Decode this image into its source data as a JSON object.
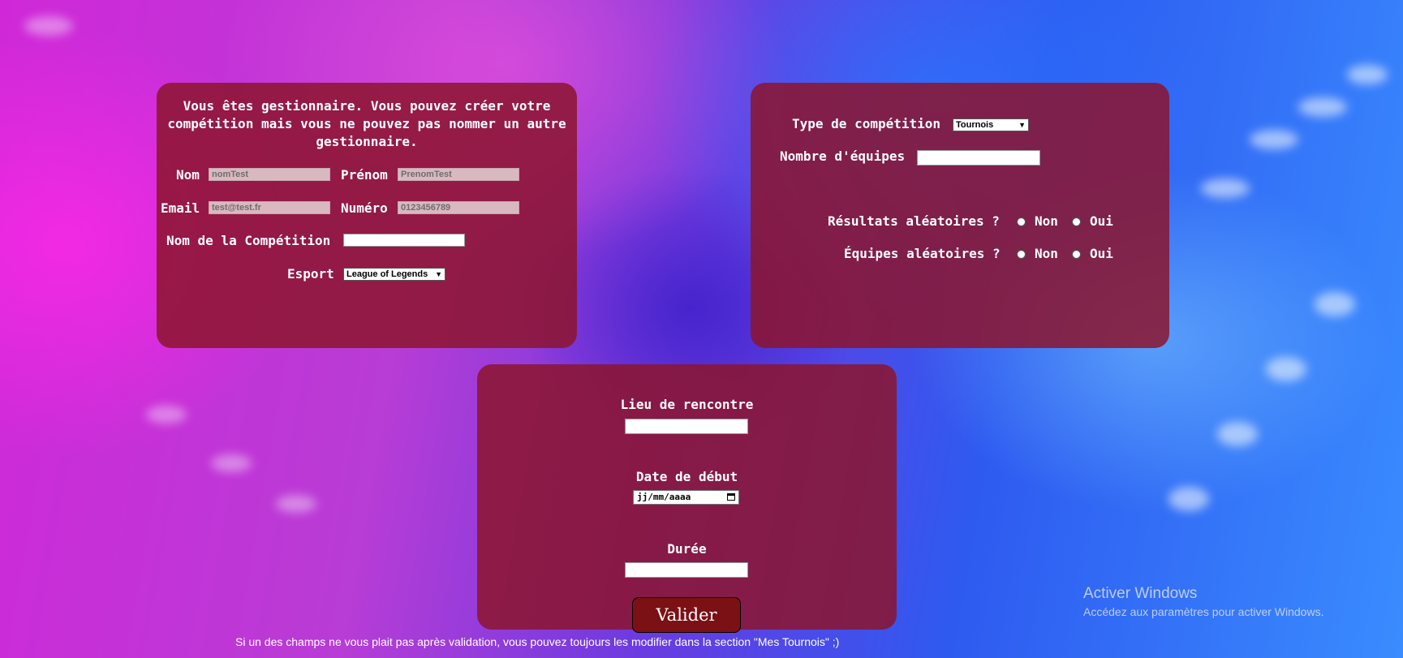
{
  "panel_left": {
    "intro": "Vous êtes gestionnaire. Vous pouvez créer votre compétition mais vous ne pouvez pas nommer un autre gestionnaire.",
    "nom_label": "Nom",
    "nom_value": "nomTest",
    "prenom_label": "Prénom",
    "prenom_value": "PrenomTest",
    "email_label": "Email",
    "email_value": "test@test.fr",
    "numero_label": "Numéro",
    "numero_value": "0123456789",
    "competition_name_label": "Nom de la Compétition",
    "competition_name_value": "",
    "esport_label": "Esport",
    "esport_selected": "League of Legends"
  },
  "panel_right": {
    "type_label": "Type de compétition",
    "type_selected": "Tournois",
    "teams_label": "Nombre d'équipes",
    "teams_value": "",
    "random_results_label": "Résultats aléatoires ?",
    "random_teams_label": "Équipes aléatoires ?",
    "no_label": "Non",
    "yes_label": "Oui"
  },
  "panel_bottom": {
    "location_label": "Lieu de rencontre",
    "location_value": "",
    "start_date_label": "Date de début",
    "start_date_placeholder": "jj/mm/aaaa",
    "duration_label": "Durée",
    "duration_value": ""
  },
  "submit_label": "Valider",
  "footer_note": "Si un des champs ne vous plait pas après validation, vous pouvez toujours les modifier dans la section \"Mes Tournois\" ;)",
  "watermark": {
    "title": "Activer Windows",
    "subtitle": "Accédez aux paramètres pour activer Windows."
  }
}
